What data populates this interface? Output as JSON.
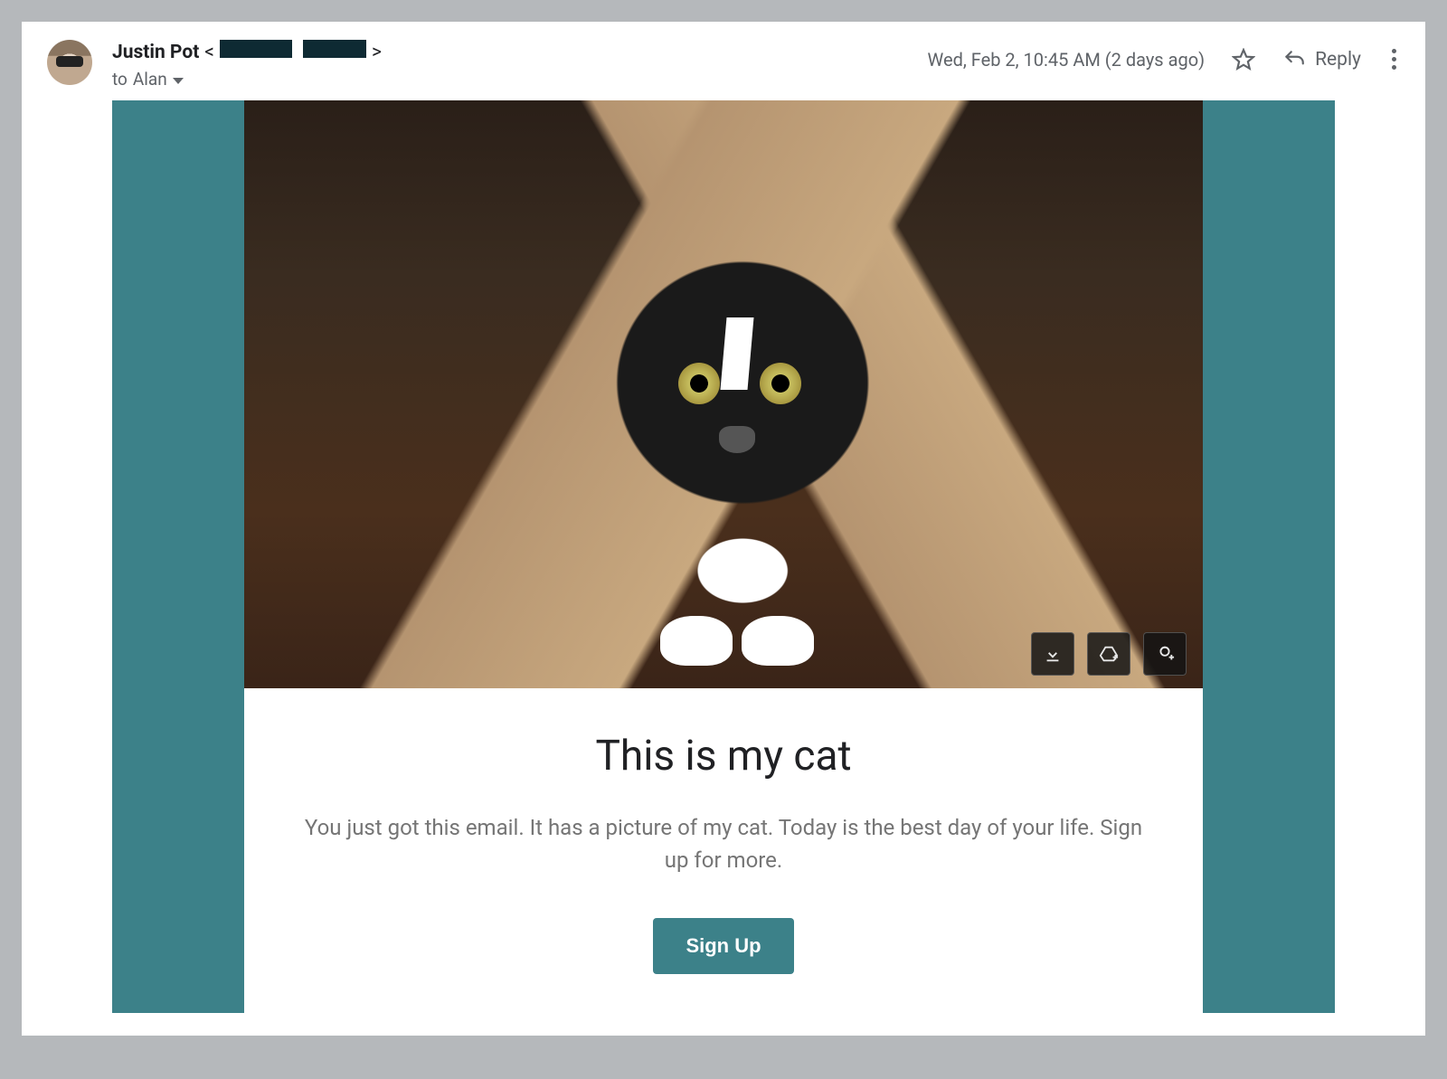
{
  "header": {
    "sender_name": "Justin Pot",
    "email_redacted": true,
    "to_prefix": "to",
    "to_name": "Alan",
    "timestamp": "Wed, Feb 2, 10:45 AM (2 days ago)",
    "reply_label": "Reply"
  },
  "email_content": {
    "image_alt": "cat-in-paper-bag",
    "title": "This is my cat",
    "body": "You just got this email. It has a picture of my cat. Today is the best day of your life. Sign up for more.",
    "cta_label": "Sign Up"
  },
  "overlay_icons": {
    "download": "download-icon",
    "add_drive": "add-to-drive-icon",
    "add_photos": "add-to-photos-icon"
  },
  "colors": {
    "accent": "#3c8189"
  }
}
